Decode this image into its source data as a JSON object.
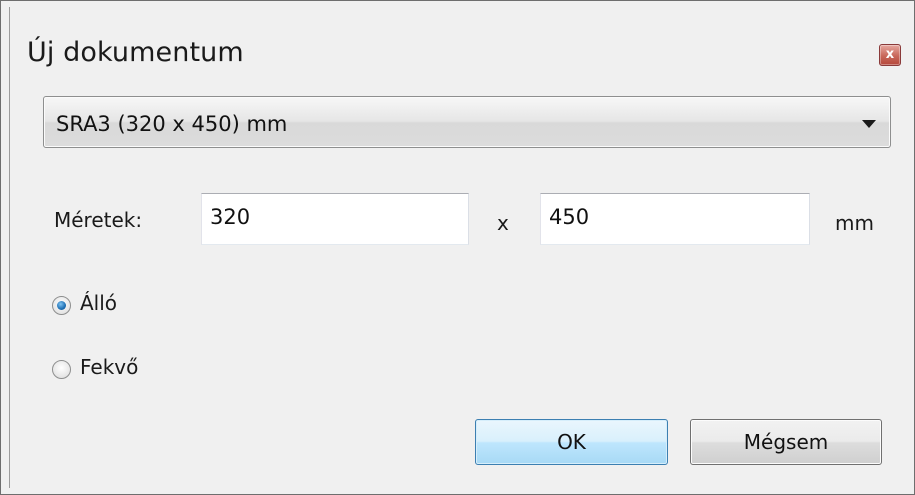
{
  "dialog": {
    "title": "Új dokumentum",
    "close_symbol": "x"
  },
  "paper_size": {
    "selected": "SRA3 (320 x 450) mm"
  },
  "dimensions": {
    "label": "Méretek:",
    "width": "320",
    "separator": "x",
    "height": "450",
    "unit": "mm"
  },
  "orientation": {
    "portrait_label": "Álló",
    "landscape_label": "Fekvő",
    "selected": "portrait"
  },
  "buttons": {
    "ok_label": "OK",
    "cancel_label": "Mégsem"
  },
  "icons": {
    "close": "close-icon",
    "dropdown": "chevron-down-icon"
  },
  "colors": {
    "dialog_background": "#f0f0f0",
    "close_button": "#c8675a",
    "default_button_border": "#3c7fb1",
    "radio_selected": "#1e6fb3"
  }
}
